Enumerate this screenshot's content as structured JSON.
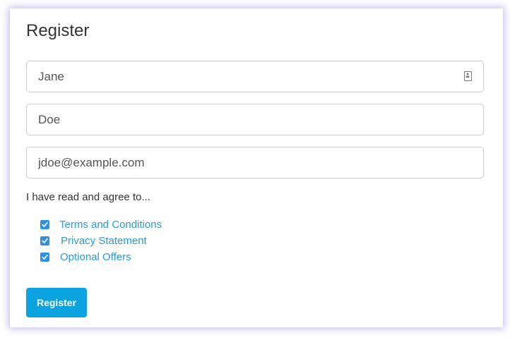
{
  "form": {
    "title": "Register",
    "fields": {
      "first_name": {
        "value": "Jane"
      },
      "last_name": {
        "value": "Doe"
      },
      "email": {
        "value": "jdoe@example.com"
      }
    },
    "agree_text": "I have read and agree to...",
    "consents": [
      {
        "label": "Terms and Conditions",
        "checked": true
      },
      {
        "label": "Privacy Statement",
        "checked": true
      },
      {
        "label": "Optional Offers",
        "checked": true
      }
    ],
    "submit_label": "Register"
  },
  "icons": {
    "first_name_field": "contact-card-icon",
    "consent_checkbox": "checkmark-icon"
  },
  "colors": {
    "accent": "#0aa3df",
    "link": "#2a9bd8",
    "checkbox": "#2d8fe6",
    "card_shadow": "#786ec8"
  }
}
